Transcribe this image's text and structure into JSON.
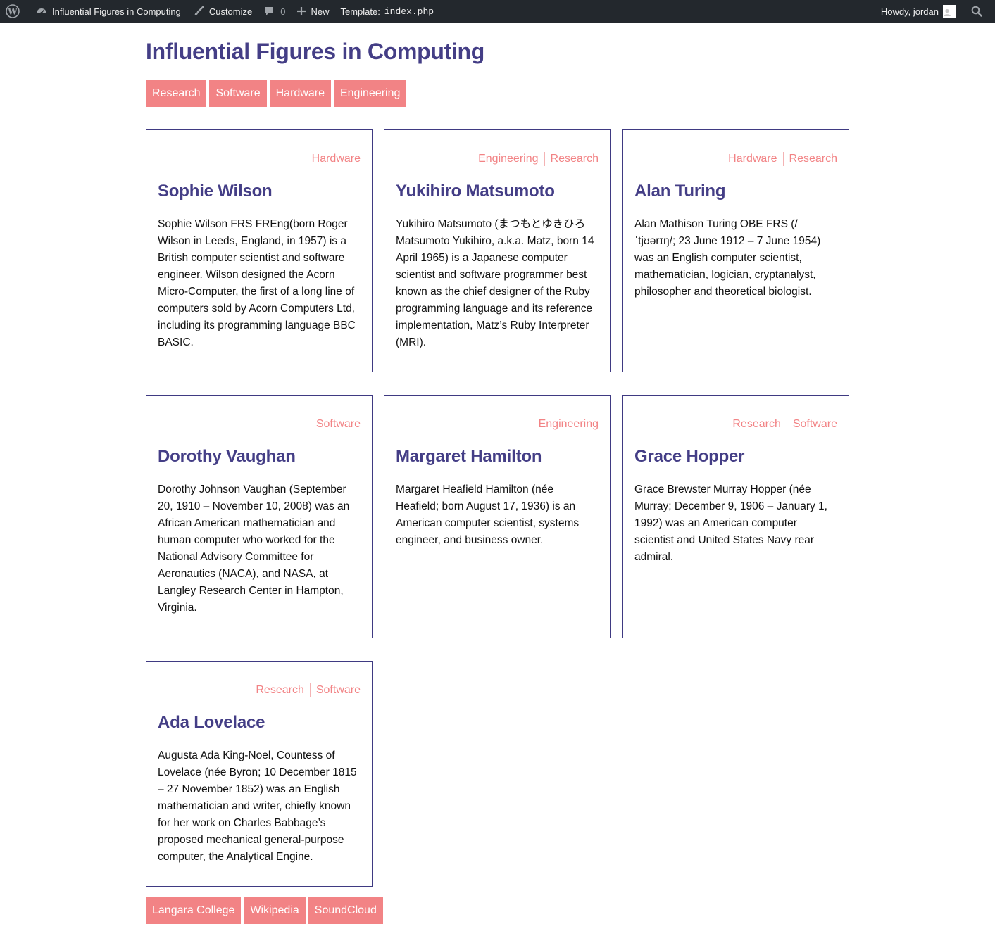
{
  "admin_bar": {
    "site_name": "Influential Figures in Computing",
    "customize": "Customize",
    "comments_count": "0",
    "new": "New",
    "template_label": "Template:",
    "template_file": "index.php",
    "greeting": "Howdy, jordan"
  },
  "page": {
    "title": "Influential Figures in Computing"
  },
  "tag_nav": [
    "Research",
    "Software",
    "Hardware",
    "Engineering"
  ],
  "cards": [
    {
      "categories": [
        "Hardware"
      ],
      "name": "Sophie Wilson",
      "description": "Sophie Wilson FRS FREng(born Roger Wilson in Leeds, England, in 1957) is a British computer scientist and software engineer. Wilson designed the Acorn Micro-Computer, the first of a long line of computers sold by Acorn Computers Ltd, including its programming language BBC BASIC."
    },
    {
      "categories": [
        "Engineering",
        "Research"
      ],
      "name": "Yukihiro Matsumoto",
      "description": "Yukihiro Matsumoto (まつもとゆきひろ Matsumoto Yukihiro, a.k.a. Matz, born 14 April 1965) is a Japanese computer scientist and software programmer best known as the chief designer of the Ruby programming language and its reference implementation, Matz’s Ruby Interpreter (MRI)."
    },
    {
      "categories": [
        "Hardware",
        "Research"
      ],
      "name": "Alan Turing",
      "description": "Alan Mathison Turing OBE FRS (/ˈtjʊərɪŋ/; 23 June 1912 – 7 June 1954) was an English computer scientist, mathematician, logician, cryptanalyst, philosopher and theoretical biologist."
    },
    {
      "categories": [
        "Software"
      ],
      "name": "Dorothy Vaughan",
      "description": "Dorothy Johnson Vaughan (September 20, 1910 – November 10, 2008) was an African American mathematician and human computer who worked for the National Advisory Committee for Aeronautics (NACA), and NASA, at Langley Research Center in Hampton, Virginia."
    },
    {
      "categories": [
        "Engineering"
      ],
      "name": "Margaret Hamilton",
      "description": "Margaret Heafield Hamilton (née Heafield; born August 17, 1936) is an American computer scientist, systems engineer, and business owner."
    },
    {
      "categories": [
        "Research",
        "Software"
      ],
      "name": "Grace Hopper",
      "description": "Grace Brewster Murray Hopper (née Murray; December 9, 1906 – January 1, 1992) was an American computer scientist and United States Navy rear admiral."
    },
    {
      "categories": [
        "Research",
        "Software"
      ],
      "name": "Ada Lovelace",
      "description": "Augusta Ada King-Noel, Countess of Lovelace (née Byron; 10 December 1815 – 27 November 1852) was an English mathematician and writer, chiefly known for her work on Charles Babbage’s proposed mechanical general-purpose computer, the Analytical Engine."
    }
  ],
  "footer_links": [
    "Langara College",
    "Wikipedia",
    "SoundCloud"
  ]
}
